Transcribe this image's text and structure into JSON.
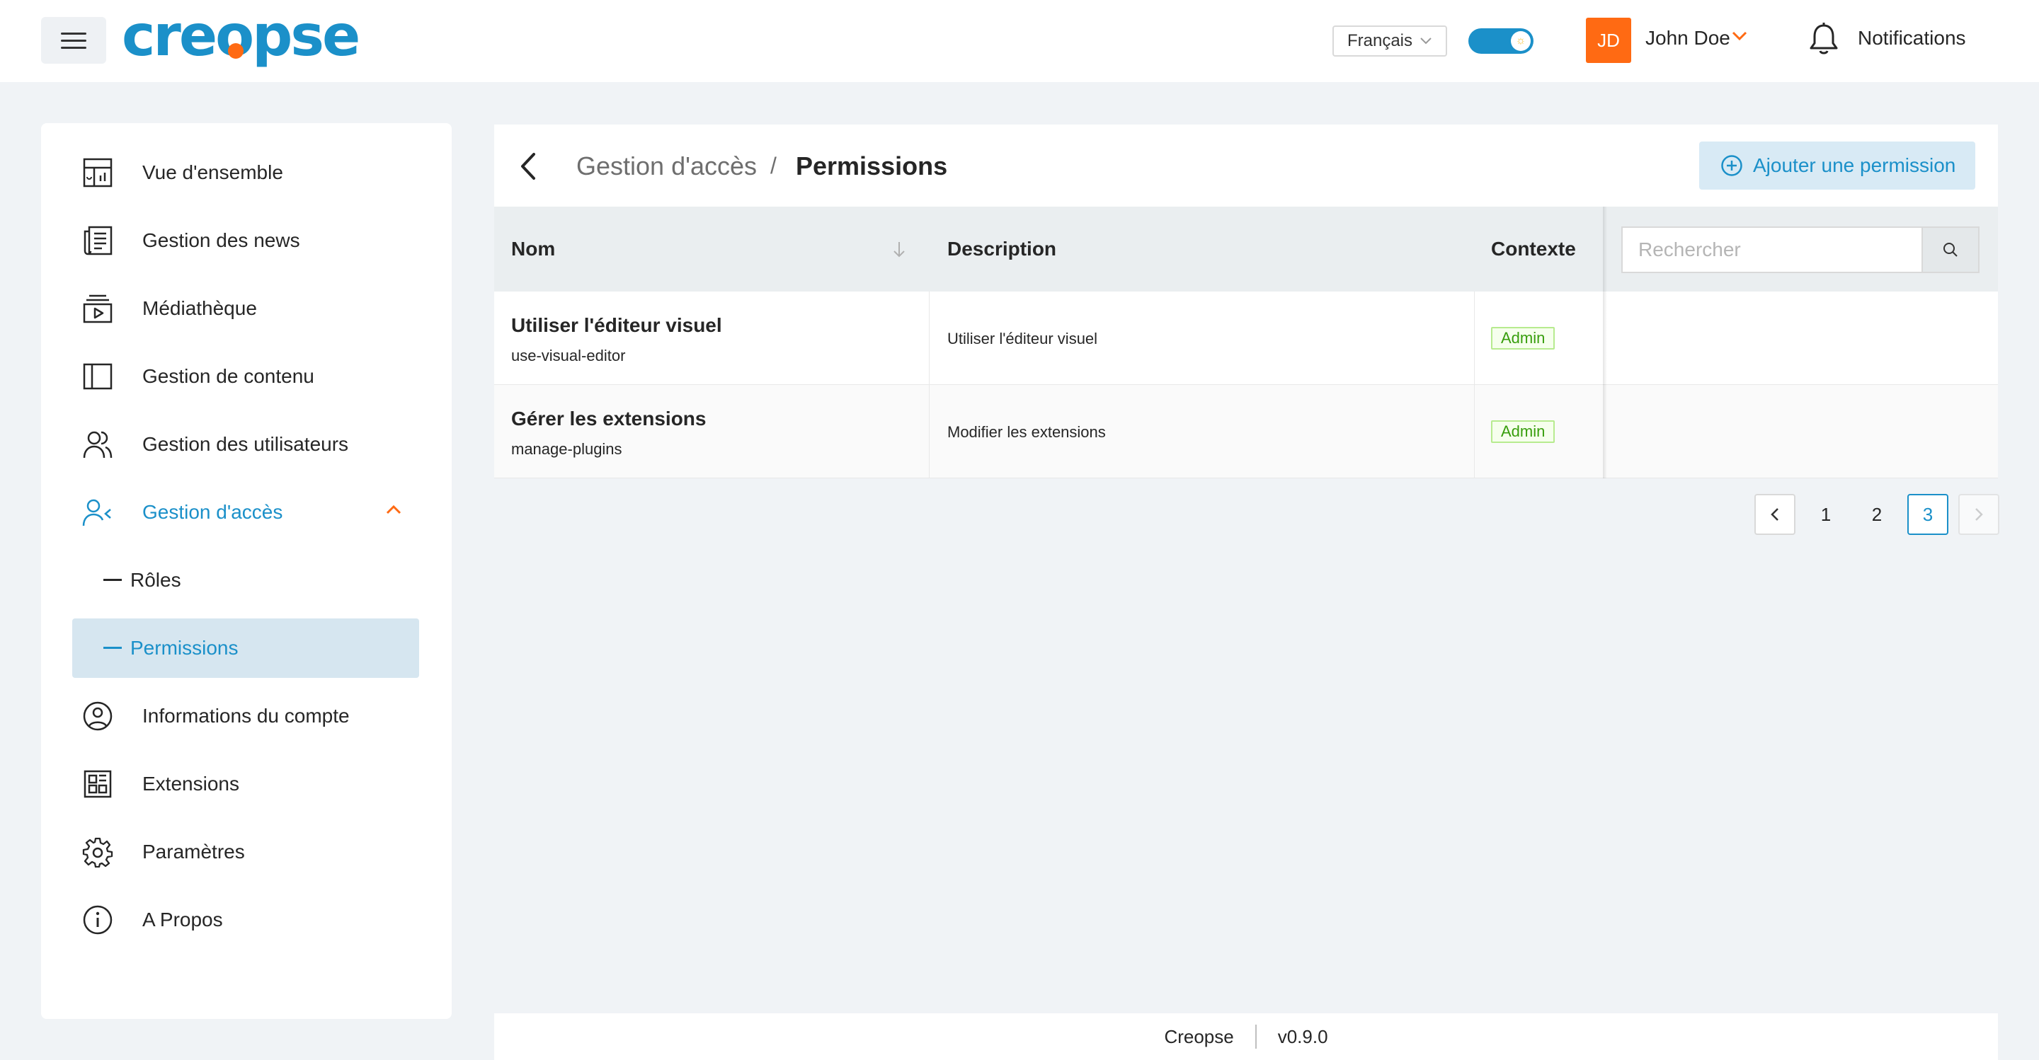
{
  "header": {
    "logo_text": "creopse",
    "language": "Français",
    "user": {
      "initials": "JD",
      "name": "John Doe"
    },
    "notifications_label": "Notifications",
    "colors": {
      "brand": "#1b90c9",
      "accent": "#ff6a13"
    }
  },
  "sidebar": {
    "items": [
      {
        "label": "Vue d'ensemble",
        "icon": "dashboard-icon"
      },
      {
        "label": "Gestion des news",
        "icon": "news-icon"
      },
      {
        "label": "Médiathèque",
        "icon": "media-icon"
      },
      {
        "label": "Gestion de contenu",
        "icon": "content-icon"
      },
      {
        "label": "Gestion des utilisateurs",
        "icon": "users-icon"
      },
      {
        "label": "Gestion d'accès",
        "icon": "access-icon",
        "expanded": true
      },
      {
        "label": "Informations du compte",
        "icon": "account-icon"
      },
      {
        "label": "Extensions",
        "icon": "extensions-icon"
      },
      {
        "label": "Paramètres",
        "icon": "settings-icon"
      },
      {
        "label": "A Propos",
        "icon": "info-icon"
      }
    ],
    "sub_items": [
      {
        "label": "Rôles"
      },
      {
        "label": "Permissions",
        "selected": true
      }
    ]
  },
  "main": {
    "breadcrumb": {
      "parent": "Gestion d'accès",
      "separator": "/",
      "current": "Permissions"
    },
    "add_button_label": "Ajouter une permission",
    "table": {
      "columns": {
        "name": "Nom",
        "description": "Description",
        "context": "Contexte"
      },
      "search_placeholder": "Rechercher",
      "rows": [
        {
          "name": "Utiliser l'éditeur visuel",
          "code": "use-visual-editor",
          "description": "Utiliser l'éditeur visuel",
          "context": "Admin"
        },
        {
          "name": "Gérer les extensions",
          "code": "manage-plugins",
          "description": "Modifier les extensions",
          "context": "Admin"
        }
      ]
    },
    "pagination": {
      "pages": [
        "1",
        "2",
        "3"
      ],
      "current": "3"
    }
  },
  "footer": {
    "app": "Creopse",
    "version": "v0.9.0"
  }
}
